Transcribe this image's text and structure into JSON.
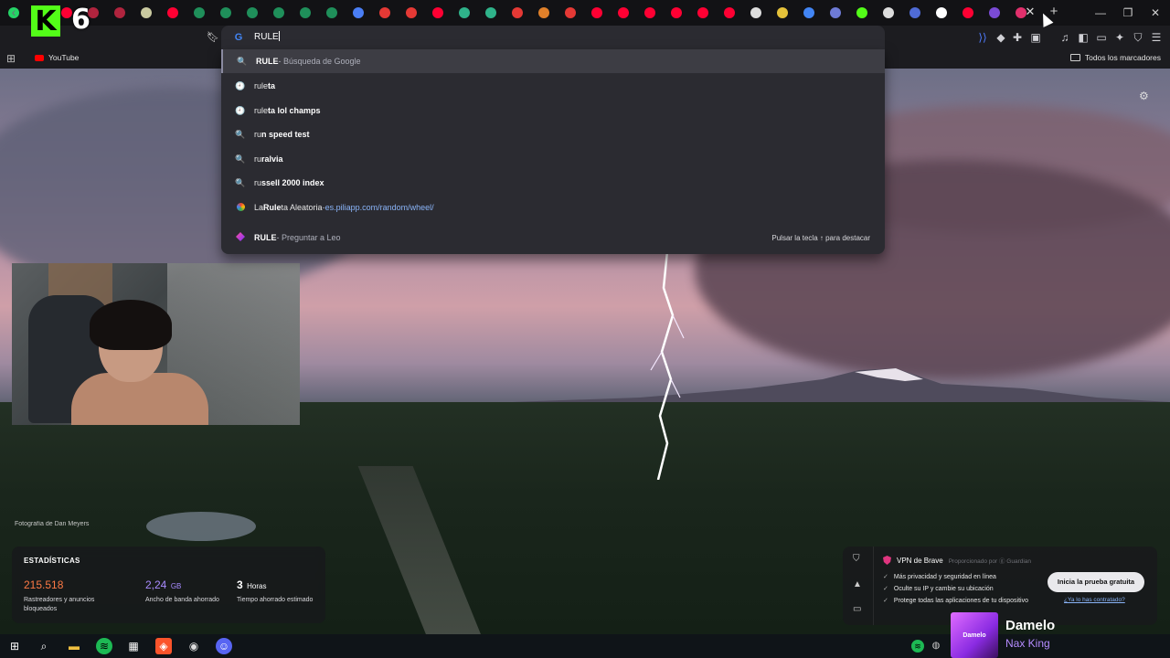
{
  "kick_badge": {
    "letter": "K",
    "count": "6"
  },
  "tabs": {
    "favicon_colors": [
      "#25d366",
      "#e53935",
      "#ff0033",
      "#b0243e",
      "#b0243e",
      "#c9c9a0",
      "#ff0033",
      "#1f8f5a",
      "#1f8f5a",
      "#1f8f5a",
      "#1f8f5a",
      "#1f8f5a",
      "#1f8f5a",
      "#4a7ef5",
      "#e53935",
      "#e53935",
      "#ff0033",
      "#2fb38a",
      "#2fb38a",
      "#e53935",
      "#e0802a",
      "#e53935",
      "#ff0033",
      "#ff0033",
      "#ff0033",
      "#ff0033",
      "#ff0033",
      "#ff0033",
      "#dddddd",
      "#e5c23a",
      "#4285f4",
      "#6e7bd6",
      "#53fc18",
      "#dddddd",
      "#4f6bd6",
      "#ffffff",
      "#ff0033",
      "#7b4bd6",
      "#e1306c"
    ],
    "close_symbol": "✕",
    "new_tab_symbol": "+"
  },
  "window_controls": {
    "minimize": "—",
    "maximize": "❐",
    "close": "✕"
  },
  "toolbar": {
    "back": "‹",
    "forward": "›",
    "reload": "↻",
    "bookmark_icon": "bookmark-icon",
    "omnibox_engine": "G",
    "omnibox_query": "RULE",
    "right_icons": [
      "wallet-icon",
      "extensions-icon",
      "puzzle-icon",
      "tab-icon",
      "music-icon",
      "sidebar-icon",
      "wallet2-icon",
      "leo-icon",
      "shield-icon",
      "menu-icon"
    ]
  },
  "bookmarks_bar": {
    "youtube_label": "YouTube",
    "all_bookmarks_label": "Todos los marcadores"
  },
  "suggestions": [
    {
      "type": "search",
      "icon": "🔍",
      "bold": "RULE",
      "rest": "",
      "suffix": " - Búsqueda de Google",
      "selected": true
    },
    {
      "type": "history",
      "icon": "🕘",
      "bold_prefix": "rule",
      "bold": "ta",
      "rest": ""
    },
    {
      "type": "history",
      "icon": "🕘",
      "bold_prefix": "rule",
      "bold": "ta lol champs",
      "rest": ""
    },
    {
      "type": "search",
      "icon": "🔍",
      "bold_prefix": "ru",
      "bold": "n speed test",
      "rest": ""
    },
    {
      "type": "search",
      "icon": "🔍",
      "bold_prefix": "ru",
      "bold": "ralvia",
      "rest": ""
    },
    {
      "type": "search",
      "icon": "🔍",
      "bold_prefix": "ru",
      "bold": "ssell 2000 index",
      "rest": ""
    },
    {
      "type": "site",
      "pre": "La ",
      "bold": "Rule",
      "rest": "ta Aleatoria",
      "sep": " - ",
      "url": "es.piliapp.com/random/wheel/"
    },
    {
      "type": "leo",
      "bold": "RULE",
      "rest": " - Preguntar a Leo",
      "hint": "Pulsar la tecla ↑ para destacar"
    }
  ],
  "photo_credit": "Fotografía de Dan Meyers",
  "stats": {
    "heading": "ESTADÍSTICAS",
    "items": [
      {
        "value": "215.518",
        "unit": "",
        "label": "Rastreadores y anuncios bloqueados",
        "color": "#ff7a45"
      },
      {
        "value": "2,24",
        "unit": "GB",
        "label": "Ancho de banda ahorrado",
        "color": "#a98bff"
      },
      {
        "value": "3",
        "unit": "Horas",
        "label": "Tiempo ahorrado estimado",
        "color": "#ffffff"
      }
    ]
  },
  "vpn": {
    "title": "VPN de Brave",
    "provider": "Proporcionado por ⓖ Guardian",
    "items": [
      "Más privacidad y seguridad en línea",
      "Oculte su IP y cambie su ubicación",
      "Protege todas las aplicaciones de tu dispositivo"
    ],
    "button": "Inicia la prueba gratuita",
    "link": "¿Ya lo has contratado?"
  },
  "now_playing": {
    "art_text": "Damelo",
    "title": "Damelo",
    "artist": "Nax King"
  }
}
